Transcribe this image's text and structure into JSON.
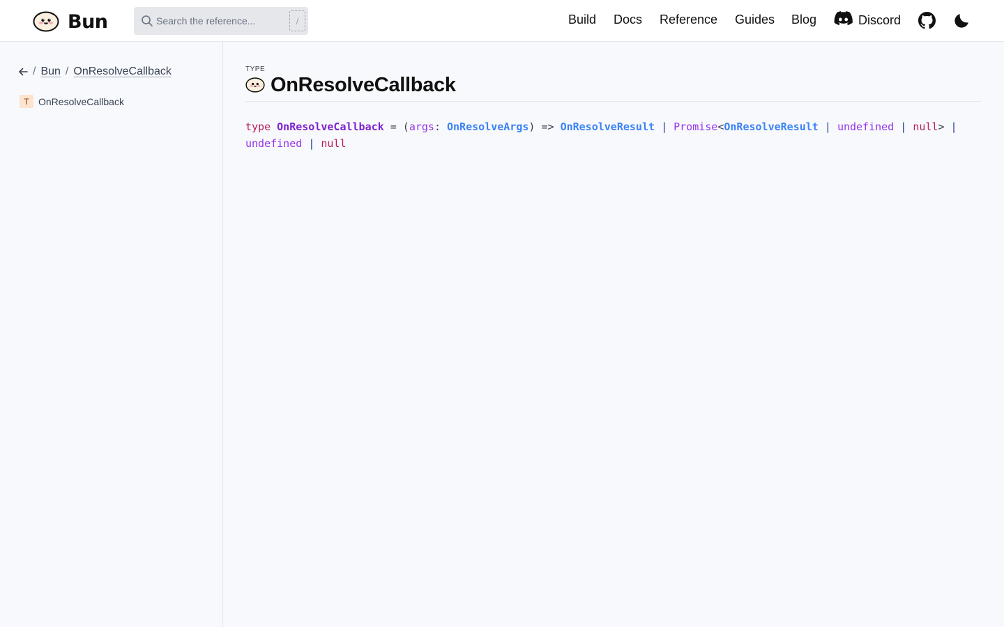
{
  "header": {
    "logo_text": "Bun",
    "search": {
      "placeholder": "Search the reference...",
      "shortcut_key": "/"
    },
    "nav": {
      "build": "Build",
      "docs": "Docs",
      "reference": "Reference",
      "guides": "Guides",
      "blog": "Blog",
      "discord": "Discord"
    },
    "icons": [
      "bun-logo-icon",
      "search-icon",
      "discord-icon",
      "github-icon",
      "moon-icon"
    ]
  },
  "sidebar": {
    "breadcrumb": [
      "Bun",
      "OnResolveCallback"
    ],
    "separator": "/",
    "items": [
      {
        "badge": "T",
        "label": "OnResolveCallback"
      }
    ]
  },
  "main": {
    "kind": "TYPE",
    "title": "OnResolveCallback",
    "signature": {
      "keyword": "type",
      "name": "OnResolveCallback",
      "equals": "=",
      "open_paren": "(",
      "param": "args",
      "colon": ":",
      "param_type": "OnResolveArgs",
      "close_paren": ")",
      "arrow": "=>",
      "return_type": "OnResolveResult",
      "pipe": "|",
      "promise": "Promise",
      "lt": "<",
      "promise_arg": "OnResolveResult",
      "undefined": "undefined",
      "null": "null",
      "gt": ">"
    }
  },
  "colors": {
    "keyword": "#b91c5c",
    "type_name": "#7e22ce",
    "type_link": "#3b82f6",
    "badge_bg": "#fde4cf"
  }
}
